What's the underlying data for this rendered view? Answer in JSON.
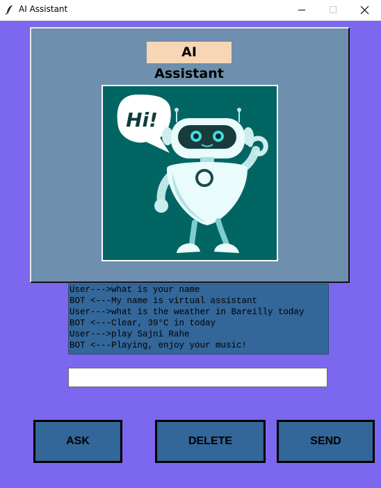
{
  "window": {
    "title": "AI Assistant",
    "controls": [
      "minimize-icon",
      "maximize-icon",
      "close-icon"
    ]
  },
  "header": {
    "title": "AI Assistant",
    "speech_bubble": "Hi!"
  },
  "chat": {
    "lines": [
      "User--->what is your name",
      "BOT <---My name is virtual assistant",
      "User--->what is the weather in Bareilly today",
      "BOT <---Clear, 39°C in today",
      "User--->play Sajni Rahe",
      "BOT <---Playing, enjoy your music!"
    ]
  },
  "input": {
    "value": "",
    "placeholder": ""
  },
  "buttons": {
    "ask": "ASK",
    "delete": "DELETE",
    "send": "SEND"
  },
  "colors": {
    "background": "#7b68ee",
    "panel": "#6e8fad",
    "title_bg": "#f7d6b5",
    "image_bg": "#016663",
    "chat_bg": "#336699",
    "button_bg": "#336699"
  }
}
